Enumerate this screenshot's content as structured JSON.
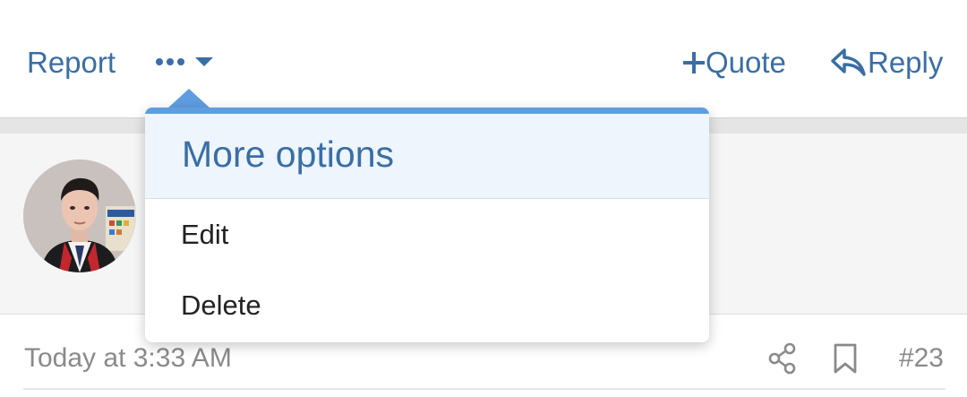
{
  "header": {
    "report_label": "Report",
    "quote_label": "Quote",
    "reply_label": "Reply"
  },
  "icons": {
    "more": "ellipsis-icon",
    "more_caret": "caret-down-icon",
    "quote": "plus-icon",
    "reply": "reply-arrow-icon",
    "share": "share-icon",
    "bookmark": "bookmark-icon"
  },
  "menu": {
    "title": "More options",
    "items": [
      {
        "label": "Edit"
      },
      {
        "label": "Delete"
      }
    ]
  },
  "post": {
    "timestamp": "Today at 3:33 AM",
    "number": "#23"
  },
  "colors": {
    "link": "#3a6ea5",
    "menu_accent": "#5e9de0",
    "menu_header_bg": "#eef5fc",
    "muted_text": "#8a8a8a"
  }
}
